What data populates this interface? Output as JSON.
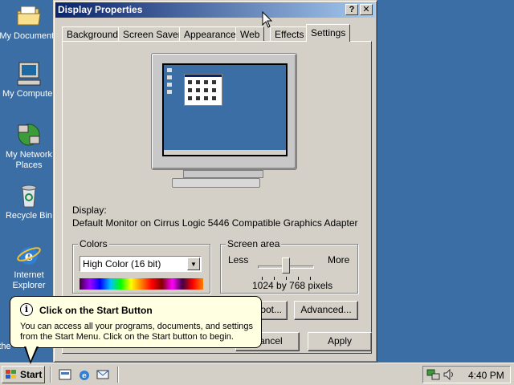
{
  "desktop": {
    "icons": [
      {
        "label_1": "My Documents",
        "label_2": ""
      },
      {
        "label_1": "My Computer",
        "label_2": ""
      },
      {
        "label_1": "My Network",
        "label_2": "Places"
      },
      {
        "label_1": "Recycle Bin",
        "label_2": ""
      },
      {
        "label_1": "Internet",
        "label_2": "Explorer"
      }
    ],
    "partial_label": "the"
  },
  "window": {
    "title": "Display Properties",
    "help_button": "?",
    "close_button": "✕",
    "tabs": [
      {
        "label": "Background"
      },
      {
        "label": "Screen Saver"
      },
      {
        "label": "Appearance"
      },
      {
        "label": "Web"
      },
      {
        "label": "Effects"
      },
      {
        "label": "Settings"
      }
    ],
    "active_tab": "Settings",
    "display_label": "Display:",
    "display_value": "Default Monitor on Cirrus Logic 5446 Compatible Graphics Adapter",
    "colors": {
      "group_title": "Colors",
      "selected": "High Color (16 bit)"
    },
    "screen_area": {
      "group_title": "Screen area",
      "less_label": "Less",
      "more_label": "More",
      "value_text": "1024 by 768 pixels",
      "slider_fraction": 0.5
    },
    "buttons": {
      "troubleshoot_partial": "oot...",
      "advanced": "Advanced...",
      "cancel_partial": "Cancel",
      "apply": "Apply"
    }
  },
  "balloon": {
    "title": "Click on the Start Button",
    "body": "You can access all your programs, documents, and settings from the Start Menu. Click on the Start button to begin."
  },
  "taskbar": {
    "start_label": "Start",
    "clock": "4:40 PM"
  },
  "colors": {
    "desktop": "#3a6ea5",
    "title_gradient_start": "#0a246a",
    "title_gradient_end": "#a6caf0",
    "face": "#d4d0c8",
    "balloon_bg": "#ffffe1"
  }
}
